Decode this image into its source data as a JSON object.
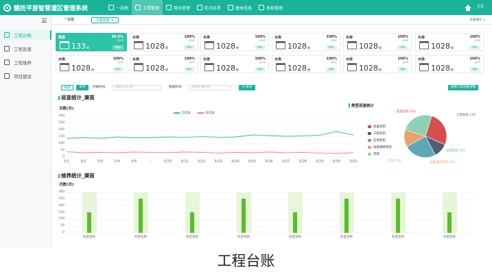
{
  "app": {
    "title": "赣抚平原智慧灌区管理系统",
    "user": "主页"
  },
  "nav": [
    {
      "label": "一张图",
      "icon": "map-icon"
    },
    {
      "label": "工程管理",
      "icon": "engineering-icon"
    },
    {
      "label": "用水管理",
      "icon": "water-icon"
    },
    {
      "label": "防汛抗旱",
      "icon": "flood-icon"
    },
    {
      "label": "基本信息",
      "icon": "info-icon"
    },
    {
      "label": "系统管理",
      "icon": "settings-icon"
    }
  ],
  "sidebar": [
    {
      "label": "工程台账",
      "icon": "ledger-icon"
    },
    {
      "label": "工程巡查",
      "icon": "inspect-icon"
    },
    {
      "label": "工程维养",
      "icon": "maintain-icon"
    },
    {
      "label": "项目建设",
      "icon": "project-icon"
    }
  ],
  "tabs": {
    "items": [
      "一张图",
      "工程巡查 ×"
    ],
    "ops": "页面操作 ∨"
  },
  "cards": [
    {
      "title": "渠首",
      "value": "133",
      "unit": "座",
      "pct": "96.5%",
      "sub": "完好率",
      "badge": "详情>"
    },
    {
      "title": "水库",
      "value": "1028",
      "unit": "座",
      "pct": "100%",
      "sub": "完好率",
      "badge": "详情>"
    },
    {
      "title": "水库",
      "value": "1028",
      "unit": "座",
      "pct": "100%",
      "sub": "完好率",
      "badge": "详情>"
    },
    {
      "title": "水库",
      "value": "1028",
      "unit": "座",
      "pct": "100%",
      "sub": "完好率",
      "badge": "详情>"
    },
    {
      "title": "水库",
      "value": "1028",
      "unit": "座",
      "pct": "100%",
      "sub": "完好率",
      "badge": "详情>"
    },
    {
      "title": "水库",
      "value": "1028",
      "unit": "座",
      "pct": "100%",
      "sub": "完好率",
      "badge": "详情>"
    },
    {
      "title": "水库",
      "value": "1028",
      "unit": "座",
      "pct": "100%",
      "sub": "完好率",
      "badge": "详情>"
    },
    {
      "title": "水库",
      "value": "1028",
      "unit": "座",
      "pct": "100%",
      "sub": "完好率",
      "badge": "详情>"
    },
    {
      "title": "水库",
      "value": "1028",
      "unit": "座",
      "pct": "100%",
      "sub": "完好率",
      "badge": "详情>"
    },
    {
      "title": "水库",
      "value": "1028",
      "unit": "座",
      "pct": "100%",
      "sub": "完好率",
      "badge": "详情>"
    },
    {
      "title": "水库",
      "value": "1028",
      "unit": "座",
      "pct": "100%",
      "sub": "完好率",
      "badge": "详情>"
    },
    {
      "title": "水库",
      "value": "1028",
      "unit": "座",
      "pct": "100%",
      "sub": "完好率",
      "badge": "详情>"
    }
  ],
  "filter": {
    "btn_week": "本周",
    "btn_month": "本月",
    "start_label": "开始时间:",
    "start_value": "2021-05-31",
    "end_label": "结束时间:",
    "end_value": "2021-06-01",
    "query": "Q 查询",
    "export": "查看工程台账详情"
  },
  "inspection": {
    "title": "巡查统计_渠首",
    "unit": "次数(次)"
  },
  "maintenance": {
    "title": "维养统计_渠首",
    "unit": "次数(次)"
  },
  "pie": {
    "title": "类型巡查统计"
  },
  "caption": "工程台账",
  "chart_data": [
    {
      "type": "line",
      "title": "巡查统计_渠首",
      "ylabel": "次数(次)",
      "x": [
        "5/1",
        "5/2",
        "5/3",
        "5/4",
        "5/5",
        "...",
        "5/20",
        "5/21",
        "5/22",
        "5/23",
        "5/24",
        "5/25",
        "5/26",
        "5/27",
        "5/28",
        "5/29",
        "5/30",
        "5/31"
      ],
      "ylim": [
        0,
        300
      ],
      "yticks": [
        "300",
        "250",
        "200",
        "150",
        "100",
        "50",
        "0"
      ],
      "series": [
        {
          "name": "已巡查",
          "color": "#2bb9a1",
          "values": [
            140,
            145,
            140,
            150,
            145,
            145,
            150,
            148,
            152,
            148,
            150,
            165,
            160,
            155,
            158,
            162,
            190,
            165
          ]
        },
        {
          "name": "未巡查",
          "color": "#ef7d6a",
          "values": [
            42,
            35,
            38,
            36,
            40,
            38,
            36,
            40,
            38,
            32,
            38,
            35,
            40,
            36,
            38,
            32,
            30,
            35
          ]
        }
      ],
      "legend": "top-center",
      "grid": true
    },
    {
      "type": "pie",
      "title": "类型巡查统计",
      "series": [
        {
          "name": "巡查巡检",
          "value": 335,
          "color": "#d64e4e",
          "label": "巡查巡检 335"
        },
        {
          "name": "工程巡检",
          "value": 135,
          "color": "#4f5d77",
          "label": "工程巡检 135"
        },
        {
          "name": "应急巡检",
          "value": 310,
          "color": "#5fa7b5",
          "label": "应急巡检 310"
        },
        {
          "name": "设备维修巡检",
          "value": 163,
          "color": "#e9a16f",
          "label": "设备维修巡检 163"
        },
        {
          "name": "其他",
          "value": 310,
          "color": "#8fd1b4",
          "label": "其他 310"
        }
      ],
      "legend": "left"
    },
    {
      "type": "bar",
      "title": "维养统计_渠首",
      "ylabel": "次数(次)",
      "categories": [
        "科室名称",
        "科室名称",
        "科室名称",
        "科室名称",
        "科室名称",
        "科室名称",
        "科室名称",
        "科室名称"
      ],
      "ylim": [
        0,
        300
      ],
      "yticks": [
        "300",
        "250",
        "200",
        "150",
        "100",
        "50",
        "0"
      ],
      "values": [
        155,
        255,
        155,
        255,
        155,
        255,
        255,
        155
      ],
      "background": 300,
      "color": "#5bbd2b"
    }
  ]
}
